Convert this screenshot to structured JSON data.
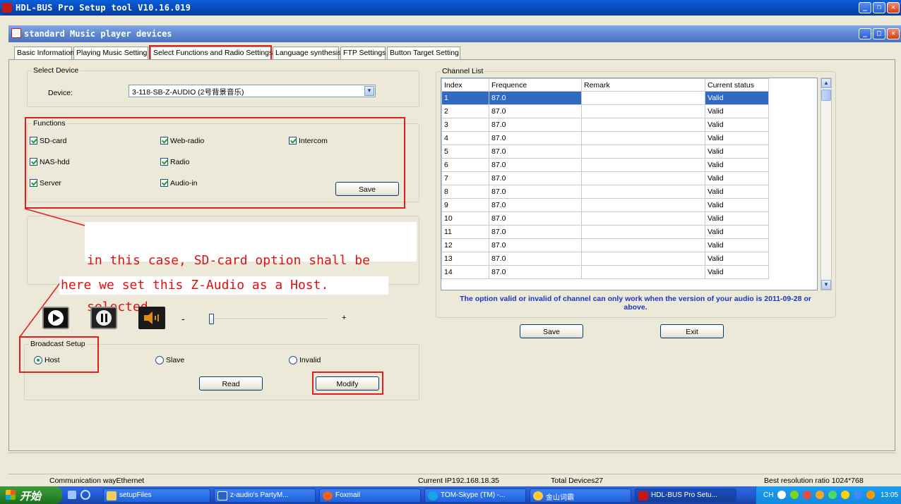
{
  "outer_window": {
    "title": "HDL-BUS Pro Setup tool V10.16.019"
  },
  "inner_window": {
    "title": "standard Music player devices"
  },
  "tabs": [
    "Basic Information",
    "Playing Music Setting",
    "Select Functions and Radio Settings",
    "Language synthesis",
    "FTP Settings",
    "Button Target Setting"
  ],
  "select_device": {
    "legend": "Select Device",
    "label": "Device:",
    "value": "3-118-SB-Z-AUDIO (2号背景音乐)"
  },
  "functions": {
    "legend": "Functions",
    "options": [
      "SD-card",
      "Web-radio",
      "Intercom",
      "NAS-hdd",
      "Radio",
      "Server",
      "Audio-in"
    ],
    "save_label": "Save"
  },
  "annotations": {
    "sd_card_note_line1": "in this case, SD-card option shall be",
    "sd_card_note_line2": "selected.",
    "host_note": "here we set this Z-Audio as a Host."
  },
  "player": {
    "volume_minus": "-",
    "volume_plus": "+",
    "volume_level": 0.02
  },
  "broadcast": {
    "legend": "Broadcast Setup",
    "options": [
      "Host",
      "Slave",
      "Invalid"
    ],
    "selected": "Host",
    "read_label": "Read",
    "modify_label": "Modify"
  },
  "channel_list": {
    "legend": "Channel List",
    "columns": [
      "Index",
      "Frequence",
      "Remark",
      "Current status"
    ],
    "rows": [
      [
        "1",
        "87.0",
        "",
        "Valid"
      ],
      [
        "2",
        "87.0",
        "",
        "Valid"
      ],
      [
        "3",
        "87.0",
        "",
        "Valid"
      ],
      [
        "4",
        "87.0",
        "",
        "Valid"
      ],
      [
        "5",
        "87.0",
        "",
        "Valid"
      ],
      [
        "6",
        "87.0",
        "",
        "Valid"
      ],
      [
        "7",
        "87.0",
        "",
        "Valid"
      ],
      [
        "8",
        "87.0",
        "",
        "Valid"
      ],
      [
        "9",
        "87.0",
        "",
        "Valid"
      ],
      [
        "10",
        "87.0",
        "",
        "Valid"
      ],
      [
        "11",
        "87.0",
        "",
        "Valid"
      ],
      [
        "12",
        "87.0",
        "",
        "Valid"
      ],
      [
        "13",
        "87.0",
        "",
        "Valid"
      ],
      [
        "14",
        "87.0",
        "",
        "Valid"
      ]
    ],
    "note_line1": "The option valid or invalid of channel can only work when the version of your audio is 2011-09-28 or",
    "note_line2": "above.",
    "save_label": "Save",
    "exit_label": "Exit"
  },
  "status_bar": {
    "communication": "Communication wayEthernet",
    "current_ip": "Current IP192.168.18.35",
    "total_devices": "Total Devices27",
    "resolution": "Best resolution ratio 1024*768"
  },
  "taskbar": {
    "start": "开始",
    "tasks": [
      "setupFiles",
      "z-audio's PartyM...",
      "Foxmail",
      "TOM-Skype (TM) -...",
      "金山词霸",
      "HDL-BUS Pro Setu..."
    ],
    "tray_lang": "CH",
    "clock": "13:05"
  },
  "colors": {
    "annotation_red": "#e01010",
    "selection_blue": "#316ac5",
    "note_blue": "#1a35c7",
    "check_green": "#21a121"
  }
}
